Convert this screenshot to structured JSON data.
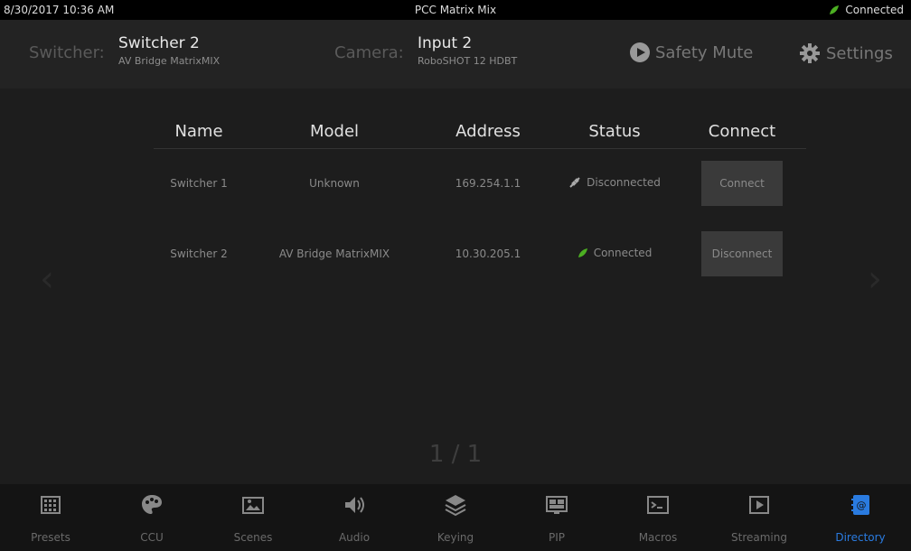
{
  "topbar": {
    "datetime": "8/30/2017 10:36 AM",
    "title": "PCC Matrix Mix",
    "status": "Connected",
    "status_color": "#4caf22"
  },
  "header": {
    "switcher_label": "Switcher:",
    "switcher_name": "Switcher 2",
    "switcher_model": "AV Bridge MatrixMIX",
    "camera_label": "Camera:",
    "camera_name": "Input 2",
    "camera_model": "RoboSHOT 12 HDBT",
    "safety_mute": "Safety Mute",
    "settings": "Settings"
  },
  "table": {
    "columns": [
      "Name",
      "Model",
      "Address",
      "Status",
      "Connect"
    ],
    "rows": [
      {
        "name": "Switcher 1",
        "model": "Unknown",
        "address": "169.254.1.1",
        "status": "Disconnected",
        "status_icon": "disconnected-plug-icon",
        "action": "Connect"
      },
      {
        "name": "Switcher 2",
        "model": "AV Bridge MatrixMIX",
        "address": "10.30.205.1",
        "status": "Connected",
        "status_icon": "connected-leaf-icon",
        "action": "Disconnect"
      }
    ]
  },
  "pager": "1 / 1",
  "nav": [
    {
      "label": "Presets",
      "icon": "presets-grid-icon"
    },
    {
      "label": "CCU",
      "icon": "palette-icon"
    },
    {
      "label": "Scenes",
      "icon": "scenes-picture-icon"
    },
    {
      "label": "Audio",
      "icon": "speaker-icon"
    },
    {
      "label": "Keying",
      "icon": "layers-icon"
    },
    {
      "label": "PIP",
      "icon": "pip-icon"
    },
    {
      "label": "Macros",
      "icon": "terminal-icon"
    },
    {
      "label": "Streaming",
      "icon": "play-box-icon"
    },
    {
      "label": "Directory",
      "icon": "directory-icon",
      "active": true
    }
  ]
}
